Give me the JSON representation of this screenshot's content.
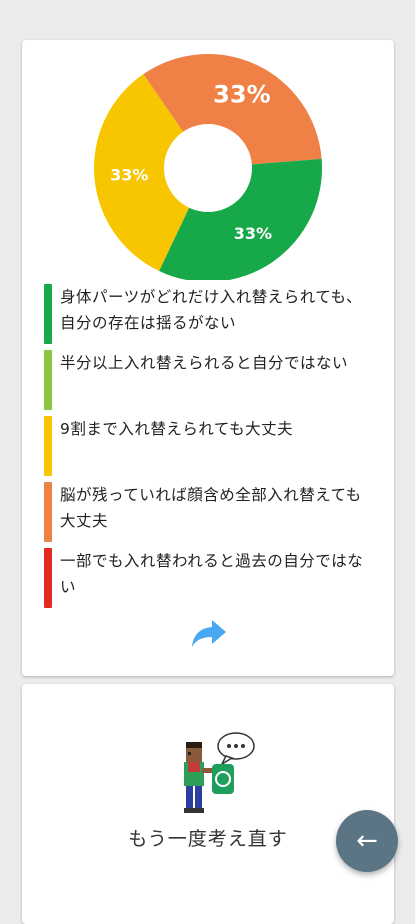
{
  "result_card": {
    "chart_data": {
      "type": "pie",
      "categories": [
        "身体パーツがどれだけ入れ替えられても、自分の存在は揺るがない",
        "半分以上入れ替えられると自分ではない",
        "9割まで入れ替えられても大丈夫",
        "脳が残っていれば顔含め全部入れ替えても大丈夫",
        "一部でも入れ替われると過去の自分ではない"
      ],
      "values": [
        33,
        0,
        33,
        33,
        0
      ],
      "colors": [
        "#17a84a",
        "#8cc63f",
        "#f7c600",
        "#ef8146",
        "#e52b1e"
      ],
      "data_labels": [
        "33%",
        "",
        "33%",
        "33%",
        ""
      ],
      "title": "",
      "donut": true
    },
    "legend": [
      {
        "text": "身体パーツがどれだけ入れ替えられても、自分の存在は揺るがない",
        "color": "#17a84a"
      },
      {
        "text": "半分以上入れ替えられると自分ではない",
        "color": "#8cc63f"
      },
      {
        "text": "9割まで入れ替えられても大丈夫",
        "color": "#f7c600"
      },
      {
        "text": "脳が残っていれば顔含め全部入れ替えても大丈夫",
        "color": "#ef8146"
      },
      {
        "text": "一部でも入れ替われると過去の自分ではない",
        "color": "#e52b1e"
      }
    ],
    "share_icon": "share-arrow-icon"
  },
  "retry_card": {
    "illustration_icon": "thinking-person-icon",
    "label": "もう一度考え直す"
  },
  "fab": {
    "icon": "arrow-left-icon",
    "glyph": "←"
  }
}
